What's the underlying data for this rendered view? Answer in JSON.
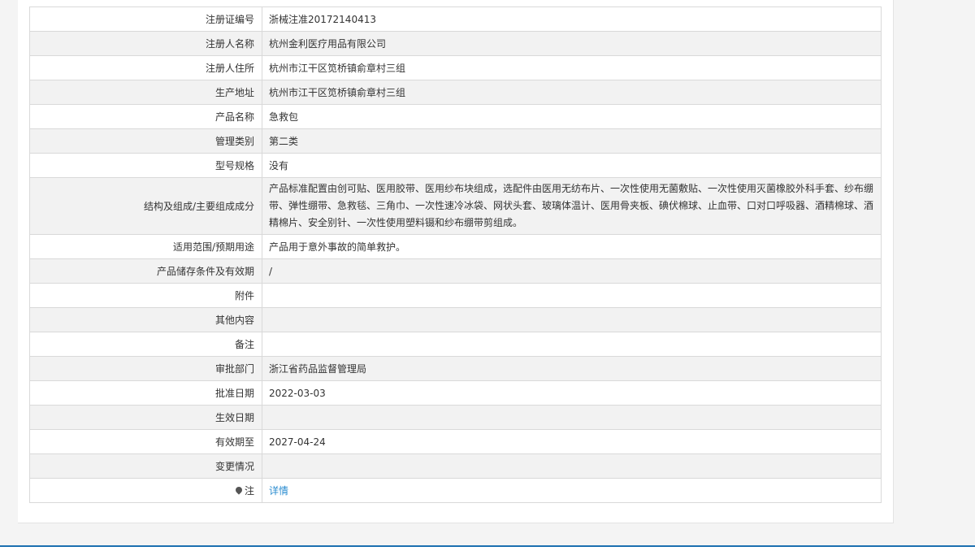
{
  "rows": [
    {
      "label": "注册证编号",
      "value": "浙械注准20172140413"
    },
    {
      "label": "注册人名称",
      "value": "杭州金利医疗用品有限公司"
    },
    {
      "label": "注册人住所",
      "value": "杭州市江干区笕桥镇俞章村三组"
    },
    {
      "label": "生产地址",
      "value": "杭州市江干区笕桥镇俞章村三组"
    },
    {
      "label": "产品名称",
      "value": "急救包"
    },
    {
      "label": "管理类别",
      "value": "第二类"
    },
    {
      "label": "型号规格",
      "value": "没有"
    },
    {
      "label": "结构及组成/主要组成成分",
      "value": "产品标准配置由创可贴、医用胶带、医用纱布块组成，选配件由医用无纺布片、一次性使用无菌敷贴、一次性使用灭菌橡胶外科手套、纱布绷带、弹性绷带、急救毯、三角巾、一次性速冷冰袋、网状头套、玻璃体温计、医用骨夹板、碘伏棉球、止血带、口对口呼吸器、酒精棉球、酒精棉片、安全别针、一次性使用塑料镊和纱布绷带剪组成。"
    },
    {
      "label": "适用范围/预期用途",
      "value": "产品用于意外事故的简单救护。"
    },
    {
      "label": "产品储存条件及有效期",
      "value": "/"
    },
    {
      "label": "附件",
      "value": ""
    },
    {
      "label": "其他内容",
      "value": ""
    },
    {
      "label": "备注",
      "value": ""
    },
    {
      "label": "审批部门",
      "value": "浙江省药品监督管理局"
    },
    {
      "label": "批准日期",
      "value": "2022-03-03"
    },
    {
      "label": "生效日期",
      "value": ""
    },
    {
      "label": "有效期至",
      "value": "2027-04-24"
    },
    {
      "label": "变更情况",
      "value": ""
    },
    {
      "label": "注",
      "value": "详情"
    }
  ],
  "icons": {
    "note": "map-pin-icon"
  },
  "colors": {
    "link": "#2a8cd0",
    "footer_border": "#1c6fb0"
  }
}
